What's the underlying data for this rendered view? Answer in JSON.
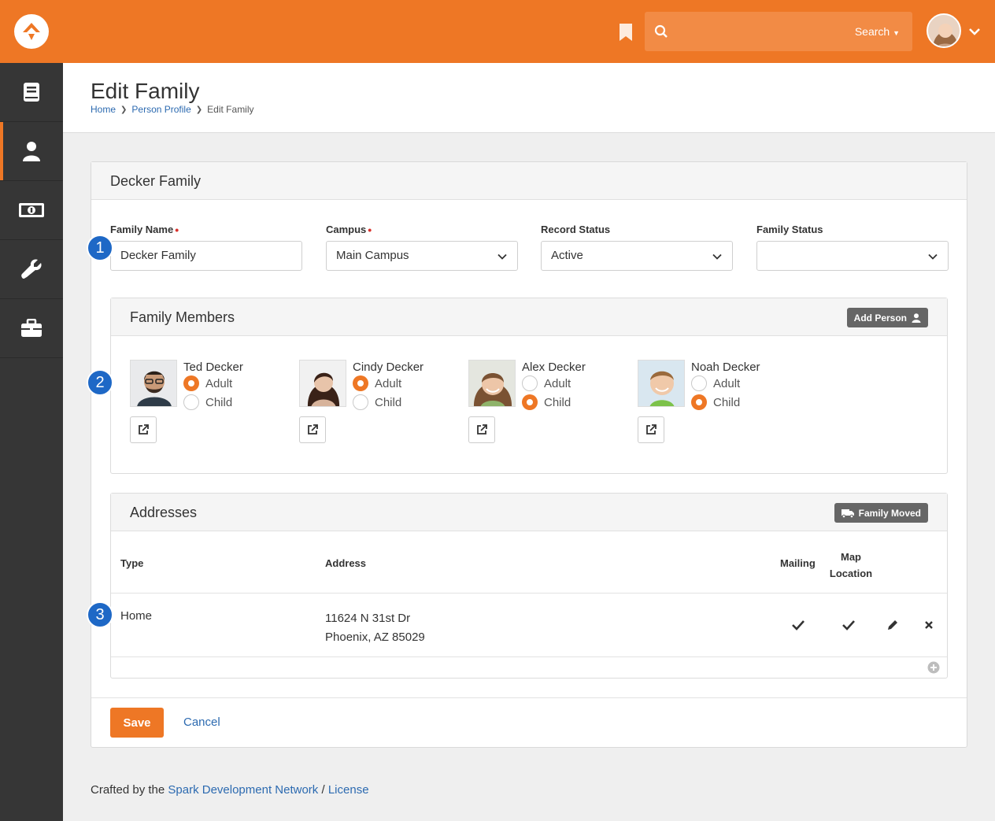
{
  "header": {
    "search_button": "Search",
    "search_placeholder": ""
  },
  "page": {
    "title": "Edit Family",
    "breadcrumb": [
      "Home",
      "Person Profile",
      "Edit Family"
    ]
  },
  "card": {
    "title": "Decker Family",
    "fields": {
      "family_name": {
        "label": "Family Name",
        "value": "Decker Family",
        "required": true
      },
      "campus": {
        "label": "Campus",
        "value": "Main Campus",
        "required": true
      },
      "record_status": {
        "label": "Record Status",
        "value": "Active"
      },
      "family_status": {
        "label": "Family Status",
        "value": ""
      }
    },
    "members_panel": {
      "title": "Family Members",
      "add_button": "Add Person",
      "option_adult": "Adult",
      "option_child": "Child",
      "members": [
        {
          "name": "Ted Decker",
          "role": "Adult"
        },
        {
          "name": "Cindy Decker",
          "role": "Adult"
        },
        {
          "name": "Alex Decker",
          "role": "Child"
        },
        {
          "name": "Noah Decker",
          "role": "Child"
        }
      ]
    },
    "addresses_panel": {
      "title": "Addresses",
      "moved_button": "Family Moved",
      "columns": {
        "type": "Type",
        "address": "Address",
        "mailing": "Mailing",
        "map_line1": "Map",
        "map_line2": "Location"
      },
      "rows": [
        {
          "type": "Home",
          "line1": "11624 N 31st Dr",
          "line2": "Phoenix, AZ 85029"
        }
      ]
    },
    "save_button": "Save",
    "cancel_link": "Cancel"
  },
  "badges": [
    "1",
    "2",
    "3"
  ],
  "footer": {
    "prefix": "Crafted by the",
    "link1": "Spark Development Network",
    "sep": "/",
    "link2": "License"
  },
  "colors": {
    "accent": "#ee7725",
    "sidebar": "#363636",
    "link": "#2c6ab0",
    "badge": "#1e68c6"
  }
}
